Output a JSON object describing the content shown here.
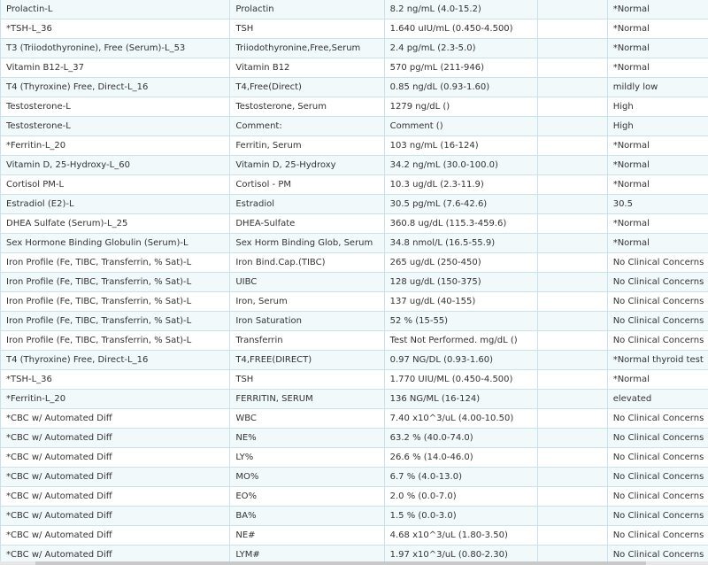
{
  "rows": [
    [
      "Prolactin-L",
      "Prolactin",
      "8.2 ng/mL (4.0-15.2)",
      "",
      "*Normal"
    ],
    [
      "*TSH-L_36",
      "TSH",
      "1.640 uIU/mL (0.450-4.500)",
      "",
      "*Normal"
    ],
    [
      "T3 (Triiodothyronine), Free (Serum)-L_53",
      "Triiodothyronine,Free,Serum",
      "2.4 pg/mL (2.3-5.0)",
      "",
      "*Normal"
    ],
    [
      "Vitamin B12-L_37",
      "Vitamin B12",
      "570 pg/mL (211-946)",
      "",
      "*Normal"
    ],
    [
      "T4 (Thyroxine) Free, Direct-L_16",
      "T4,Free(Direct)",
      "0.85 ng/dL (0.93-1.60)",
      "",
      "mildly low"
    ],
    [
      "Testosterone-L",
      "Testosterone, Serum",
      "1279 ng/dL ()",
      "",
      "High"
    ],
    [
      "Testosterone-L",
      "Comment:",
      "Comment ()",
      "",
      "High"
    ],
    [
      "*Ferritin-L_20",
      "Ferritin, Serum",
      "103 ng/mL (16-124)",
      "",
      "*Normal"
    ],
    [
      "Vitamin D, 25-Hydroxy-L_60",
      "Vitamin D, 25-Hydroxy",
      "34.2 ng/mL (30.0-100.0)",
      "",
      "*Normal"
    ],
    [
      "Cortisol PM-L",
      "Cortisol - PM",
      "10.3 ug/dL (2.3-11.9)",
      "",
      "*Normal"
    ],
    [
      "Estradiol (E2)-L",
      "Estradiol",
      "30.5 pg/mL (7.6-42.6)",
      "",
      "30.5"
    ],
    [
      "DHEA Sulfate (Serum)-L_25",
      "DHEA-Sulfate",
      "360.8 ug/dL (115.3-459.6)",
      "",
      "*Normal"
    ],
    [
      "Sex Hormone Binding Globulin (Serum)-L",
      "Sex Horm Binding Glob, Serum",
      "34.8 nmol/L (16.5-55.9)",
      "",
      "*Normal"
    ],
    [
      "Iron Profile (Fe, TIBC, Transferrin, % Sat)-L",
      "Iron Bind.Cap.(TIBC)",
      "265 ug/dL (250-450)",
      "",
      "No Clinical Concerns"
    ],
    [
      "Iron Profile (Fe, TIBC, Transferrin, % Sat)-L",
      "UIBC",
      "128 ug/dL (150-375)",
      "",
      "No Clinical Concerns"
    ],
    [
      "Iron Profile (Fe, TIBC, Transferrin, % Sat)-L",
      "Iron, Serum",
      "137 ug/dL (40-155)",
      "",
      "No Clinical Concerns"
    ],
    [
      "Iron Profile (Fe, TIBC, Transferrin, % Sat)-L",
      "Iron Saturation",
      "52 % (15-55)",
      "",
      "No Clinical Concerns"
    ],
    [
      "Iron Profile (Fe, TIBC, Transferrin, % Sat)-L",
      "Transferrin",
      "Test Not Performed. mg/dL ()",
      "",
      "No Clinical Concerns"
    ],
    [
      "T4 (Thyroxine) Free, Direct-L_16",
      "T4,FREE(DIRECT)",
      "0.97 NG/DL (0.93-1.60)",
      "",
      "*Normal thyroid test"
    ],
    [
      "*TSH-L_36",
      "TSH",
      "1.770 UIU/ML (0.450-4.500)",
      "",
      "*Normal"
    ],
    [
      "*Ferritin-L_20",
      "FERRITIN, SERUM",
      "136 NG/ML (16-124)",
      "",
      "elevated"
    ],
    [
      "*CBC w/ Automated Diff",
      "WBC",
      "7.40 x10^3/uL (4.00-10.50)",
      "",
      "No Clinical Concerns"
    ],
    [
      "*CBC w/ Automated Diff",
      "NE%",
      "63.2 % (40.0-74.0)",
      "",
      "No Clinical Concerns"
    ],
    [
      "*CBC w/ Automated Diff",
      "LY%",
      "26.6 % (14.0-46.0)",
      "",
      "No Clinical Concerns"
    ],
    [
      "*CBC w/ Automated Diff",
      "MO%",
      "6.7 % (4.0-13.0)",
      "",
      "No Clinical Concerns"
    ],
    [
      "*CBC w/ Automated Diff",
      "EO%",
      "2.0 % (0.0-7.0)",
      "",
      "No Clinical Concerns"
    ],
    [
      "*CBC w/ Automated Diff",
      "BA%",
      "1.5 % (0.0-3.0)",
      "",
      "No Clinical Concerns"
    ],
    [
      "*CBC w/ Automated Diff",
      "NE#",
      "4.68 x10^3/uL (1.80-3.50)",
      "",
      "No Clinical Concerns"
    ],
    [
      "*CBC w/ Automated Diff",
      "LYM#",
      "1.97 x10^3/uL (0.80-2.30)",
      "",
      "No Clinical Concerns"
    ]
  ],
  "colors": {
    "row_alt": "#f1f9fb",
    "row_base": "#ffffff",
    "grid": "#c9e2e9",
    "text": "#333333"
  }
}
